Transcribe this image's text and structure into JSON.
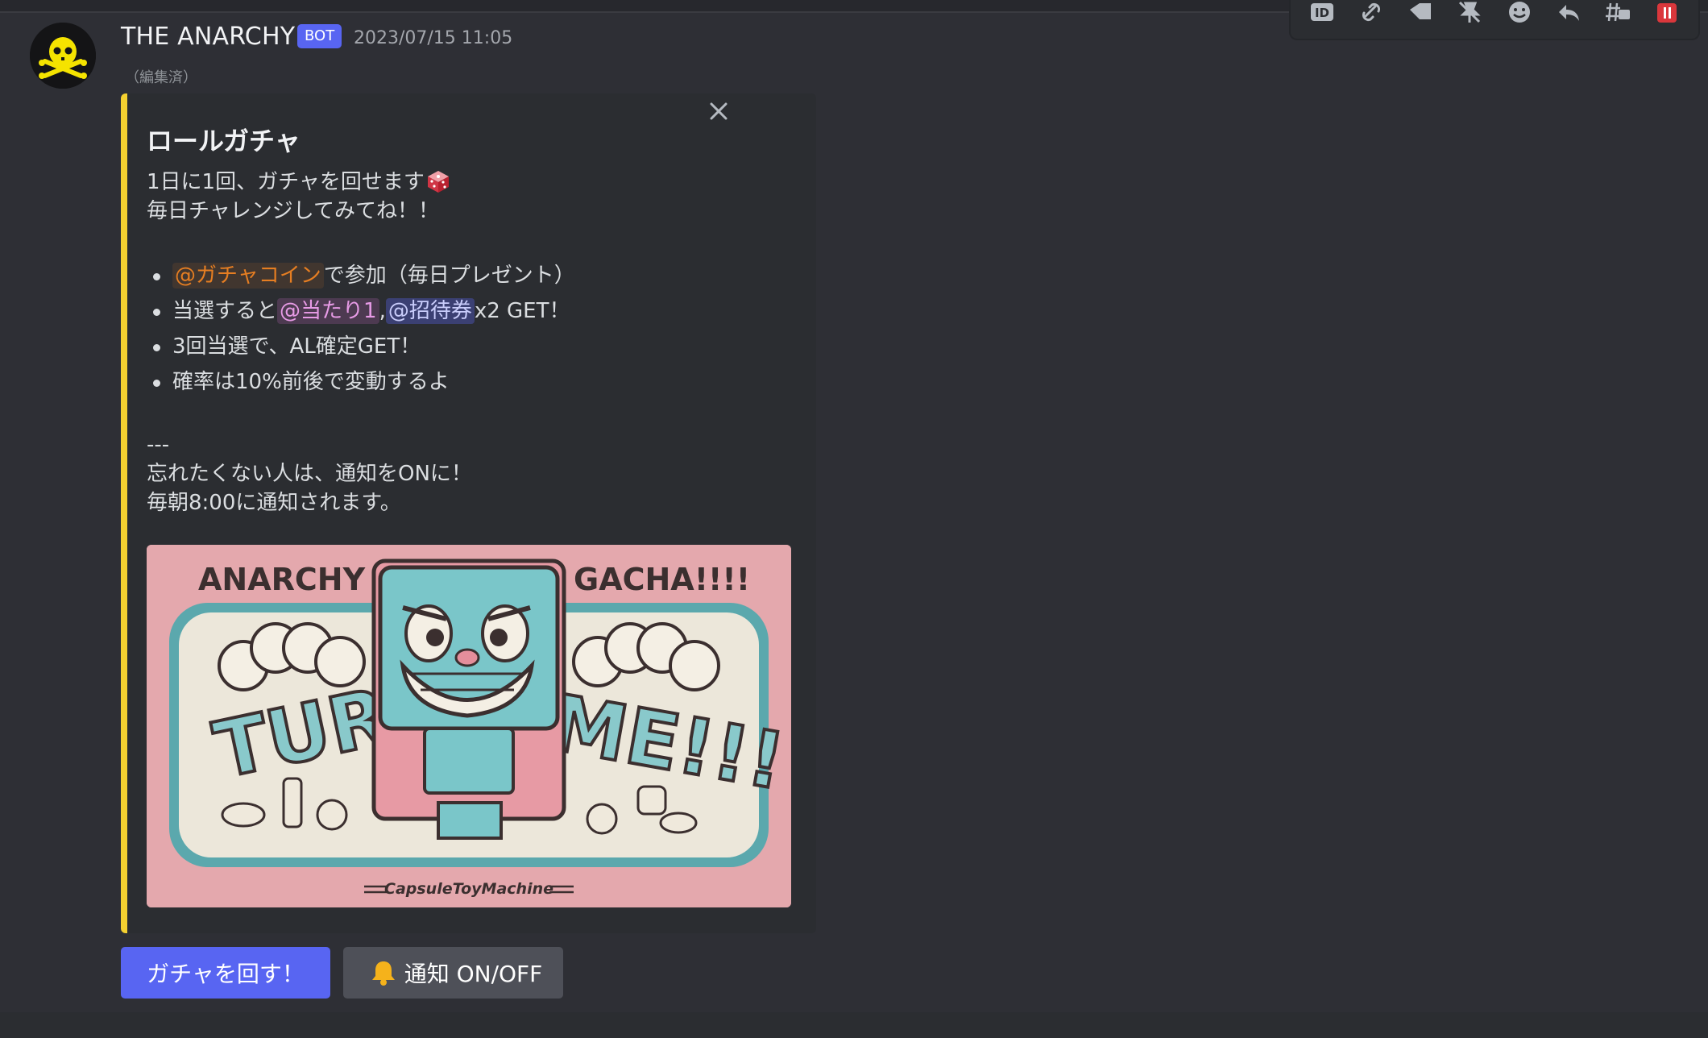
{
  "message": {
    "author": "THE ANARCHY",
    "badge": "BOT",
    "timestamp": "2023/07/15 11:05",
    "edited_label": "（編集済）",
    "avatar_icon": "skull-crossbones-icon"
  },
  "toolbar": {
    "icons": [
      "id-icon",
      "link-icon",
      "tag-icon",
      "pin-icon",
      "emoji-icon",
      "reply-icon",
      "thread-icon",
      "delete-icon"
    ]
  },
  "embed": {
    "accent_color": "#f5d130",
    "title": "ロールガチャ",
    "desc_line1": "1日に1回、ガチャを回せます",
    "desc_line2": "毎日チャレンジしてみてね！！",
    "bullets": {
      "b1_mention": "@ガチャコイン",
      "b1_text": "で参加（毎日プレゼント）",
      "b2_text_a": "当選すると",
      "b2_mention1": "@当たり1",
      "b2_sep": ",",
      "b2_mention2": "@招待券",
      "b2_text_b": "x2 GET！",
      "b3": "3回当選で、AL確定GET！",
      "b4": "確率は10%前後で変動するよ"
    },
    "separator": "---",
    "footer_line1": "忘れたくない人は、通知をONに！",
    "footer_line2": "毎朝8:00に通知されます。",
    "image": {
      "heading_left": "ANARCHY",
      "heading_right": "GACHA!!!!",
      "word_left": "TURN",
      "word_right": "ME!!!",
      "caption": "CapsuleToyMachine"
    }
  },
  "buttons": {
    "primary_label": "ガチャを回す！",
    "secondary_label": "通知 ON/OFF",
    "secondary_icon": "bell-icon"
  },
  "colors": {
    "background": "#2e2f35",
    "blurple": "#5865f2",
    "mention_orange": "#e67e22",
    "mention_pink": "#e79be6"
  }
}
